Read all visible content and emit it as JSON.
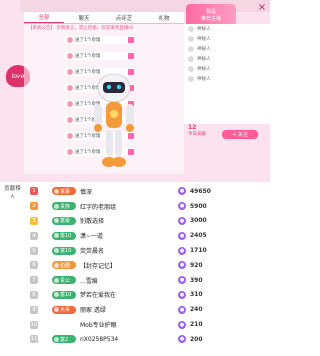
{
  "stream": {
    "tabs": [
      {
        "label": "全部"
      },
      {
        "label": "聊天"
      },
      {
        "label": "点评芝"
      },
      {
        "label": "礼物"
      }
    ],
    "promo_line1": "我是",
    "promo_line2": "推荐主播",
    "sys_msg": "【系统公告】 文明发言，禁止低俗，欢迎来到直播间",
    "gift_lines": [
      "送了1个玫瑰",
      "送了1个玫瑰",
      "送了1个玫瑰",
      "送了1个玫瑰",
      "送了1个玫瑰",
      "送了1个玫瑰",
      "送了1个玫瑰",
      "送了1个玫瑰"
    ],
    "side_items": [
      "神秘人",
      "神秘人",
      "神秘人",
      "神秘人",
      "神秘人",
      "神秘人"
    ],
    "side_stat_big": "12",
    "side_stat_label": "今日贡献",
    "follow_button": "+ 关注",
    "heart_label": "love"
  },
  "ranking": {
    "title": "贡献榜",
    "title_line2": "榜",
    "arrow": "∧",
    "rows": [
      {
        "rank": "1",
        "rank_class": "n1",
        "badge": "富豪",
        "badge_color": "#f06a3c",
        "name": "慎深",
        "score": "49650"
      },
      {
        "rank": "2",
        "rank_class": "n2",
        "badge": "贵族",
        "badge_color": "#3cb371",
        "name": "红字的老朋组",
        "score": "5900"
      },
      {
        "rank": "3",
        "rank_class": "n3",
        "badge": "富豪",
        "badge_color": "#3cb371",
        "name": "别散选择",
        "score": "3000"
      },
      {
        "rank": "4",
        "rank_class": "nx",
        "badge": "富10",
        "badge_color": "#3cb371",
        "name": "潇~一道",
        "score": "2405"
      },
      {
        "rank": "5",
        "rank_class": "nx",
        "badge": "富10",
        "badge_color": "#3cb371",
        "name": "荧荧晨名",
        "score": "1710"
      },
      {
        "rank": "6",
        "rank_class": "nx",
        "badge": "伯爵",
        "badge_color": "#f3983a",
        "name": "【封存记忆】",
        "score": "920"
      },
      {
        "rank": "7",
        "rank_class": "nx",
        "badge": "贵公",
        "badge_color": "#3cb371",
        "name": "...雪痕",
        "score": "390"
      },
      {
        "rank": "8",
        "rank_class": "nx",
        "badge": "富10",
        "badge_color": "#3cb371",
        "name": "梦若在爱我在",
        "score": "310"
      },
      {
        "rank": "9",
        "rank_class": "nx",
        "badge": "大哥",
        "badge_color": "#f06a3c",
        "name": "丽家 透绿",
        "score": "240"
      },
      {
        "rank": "10",
        "rank_class": "nx",
        "badge": "",
        "badge_color": "#ffffff",
        "name": "Mob专业护眼",
        "score": "210"
      },
      {
        "rank": "11",
        "rank_class": "nx",
        "badge": "富2",
        "badge_color": "#3cb371",
        "name": "nX0258P534",
        "score": "200"
      }
    ]
  }
}
